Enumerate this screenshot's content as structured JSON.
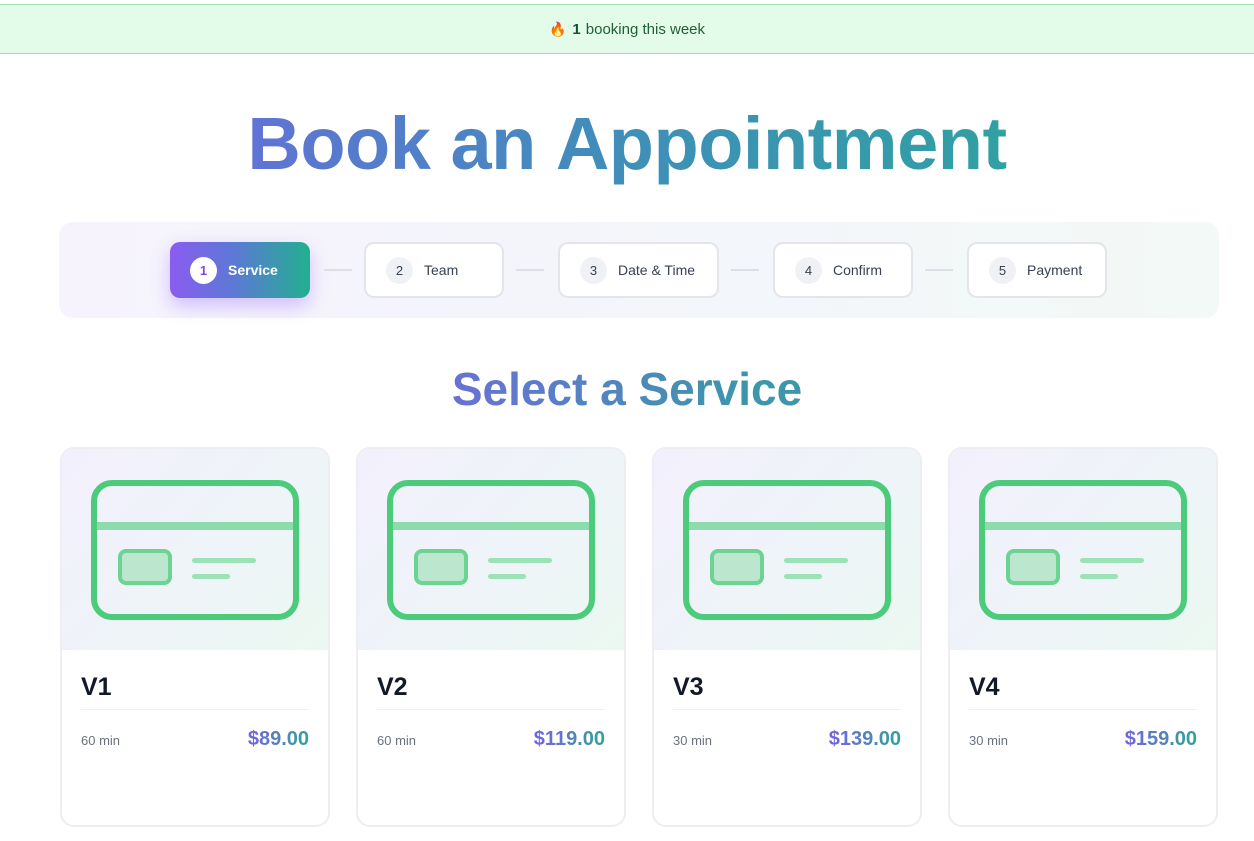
{
  "banner": {
    "icon": "fire-icon",
    "count": "1",
    "text": "booking this week"
  },
  "header": {
    "title_words": [
      "Book",
      "an",
      "Appointment"
    ]
  },
  "stepper": {
    "steps": [
      {
        "num": "1",
        "label": "Service",
        "active": true
      },
      {
        "num": "2",
        "label": "Team",
        "active": false
      },
      {
        "num": "3",
        "label": "Date & Time",
        "active": false
      },
      {
        "num": "4",
        "label": "Confirm",
        "active": false
      },
      {
        "num": "5",
        "label": "Payment",
        "active": false
      }
    ]
  },
  "section": {
    "title": "Select a Service"
  },
  "services": [
    {
      "name": "V1",
      "duration": "60 min",
      "price": "$89.00",
      "icon": "credit-card-icon"
    },
    {
      "name": "V2",
      "duration": "60 min",
      "price": "$119.00",
      "icon": "credit-card-icon"
    },
    {
      "name": "V3",
      "duration": "30 min",
      "price": "$139.00",
      "icon": "credit-card-icon"
    },
    {
      "name": "V4",
      "duration": "30 min",
      "price": "$159.00",
      "icon": "credit-card-icon"
    }
  ],
  "colors": {
    "accent_start": "#8b5cf6",
    "accent_end": "#10b981",
    "icon_green": "#4ccc7a",
    "banner_bg": "#e3fbe9"
  }
}
